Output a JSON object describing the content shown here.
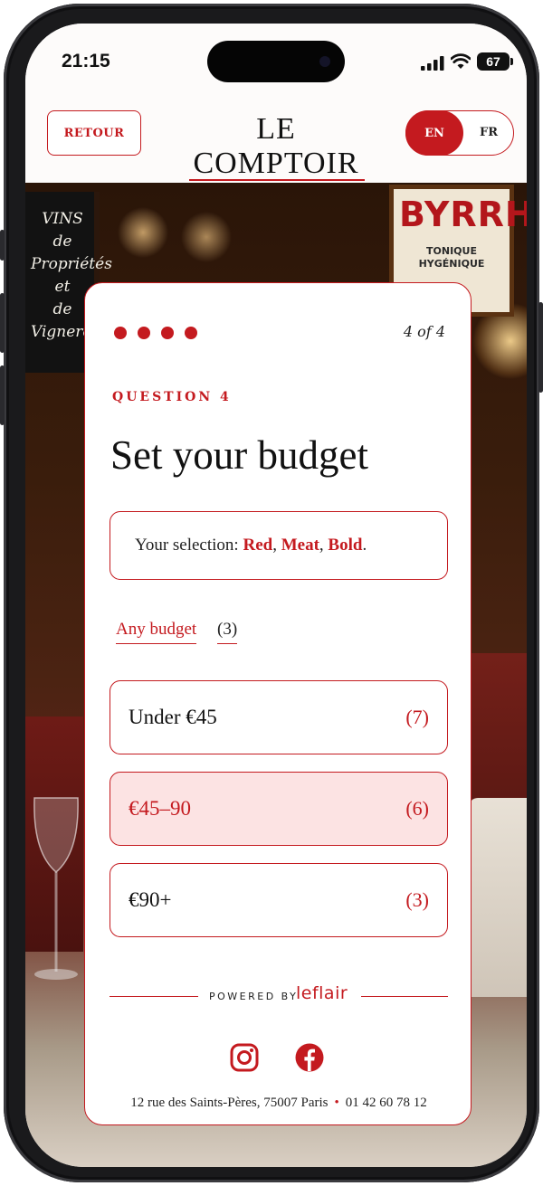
{
  "status_bar": {
    "time": "21:15",
    "battery": "67"
  },
  "header": {
    "back_label": "RETOUR",
    "logo": "LE COMPTOIR",
    "lang_en": "EN",
    "lang_fr": "FR",
    "active_lang": "EN"
  },
  "background": {
    "chalkboard_lines": [
      "VINS",
      "de",
      "Propriétés",
      "et",
      "de",
      "Vignerons"
    ],
    "poster_title": "BYRRH",
    "poster_subtitle": "TONIQUE HYGÉNIQUE"
  },
  "quiz": {
    "step": "4 of 4",
    "current_step": 4,
    "total_steps": 4,
    "question_label": "QUESTION 4",
    "title": "Set your budget",
    "selection_prefix": "Your selection:",
    "selection_items": [
      "Red",
      "Meat",
      "Bold"
    ],
    "any_budget_label": "Any budget",
    "any_budget_count": "(3)",
    "options": [
      {
        "label": "Under €45",
        "count": "(7)",
        "selected": false
      },
      {
        "label": "€45–90",
        "count": "(6)",
        "selected": true
      },
      {
        "label": "€90+",
        "count": "(3)",
        "selected": false
      }
    ]
  },
  "footer": {
    "powered_by": "POWERED BY",
    "brand": "leflair",
    "social": [
      "instagram-icon",
      "facebook-icon"
    ],
    "address": "12 rue des Saints-Pères, 75007 Paris",
    "phone": "01 42 60 78 12"
  },
  "colors": {
    "accent": "#c41a1f",
    "selected_bg": "#fce3e3",
    "card_bg": "#ffffff"
  }
}
